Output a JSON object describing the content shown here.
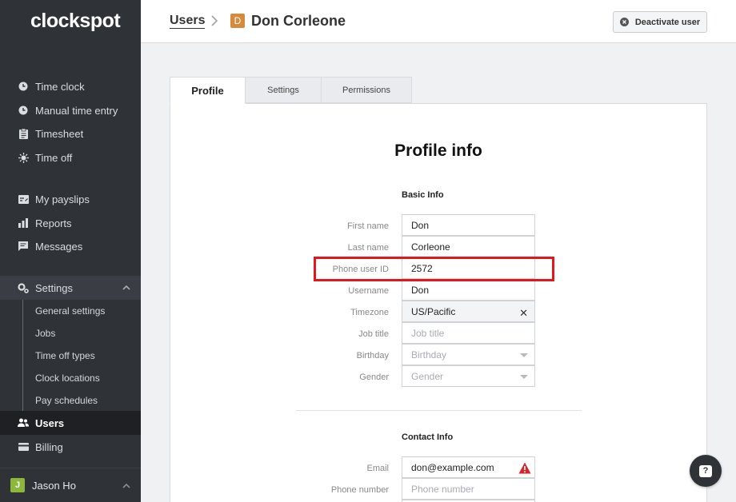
{
  "app": {
    "logo": "clockspot"
  },
  "sidebar": {
    "group1": [
      {
        "label": "Time clock",
        "icon": "clock-icon"
      },
      {
        "label": "Manual time entry",
        "icon": "clock-icon"
      },
      {
        "label": "Timesheet",
        "icon": "clipboard-icon"
      },
      {
        "label": "Time off",
        "icon": "sun-icon"
      }
    ],
    "group2": [
      {
        "label": "My payslips",
        "icon": "payslip-icon"
      },
      {
        "label": "Reports",
        "icon": "bar-chart-icon"
      },
      {
        "label": "Messages",
        "icon": "message-icon"
      }
    ],
    "settings": {
      "label": "Settings",
      "icon": "gears-icon",
      "subitems": [
        "General settings",
        "Jobs",
        "Time off types",
        "Clock locations",
        "Pay schedules"
      ]
    },
    "users": {
      "label": "Users",
      "icon": "users-icon"
    },
    "billing": {
      "label": "Billing",
      "icon": "credit-card-icon"
    },
    "user": {
      "initial": "J",
      "name": "Jason Ho"
    }
  },
  "header": {
    "breadcrumb": "Users",
    "user_initial": "D",
    "user_name": "Don Corleone",
    "deactivate_label": "Deactivate user"
  },
  "tabs": [
    "Profile",
    "Settings",
    "Permissions"
  ],
  "profile": {
    "title": "Profile info",
    "basic_title": "Basic Info",
    "basic_fields": [
      {
        "label": "First name",
        "value": "Don"
      },
      {
        "label": "Last name",
        "value": "Corleone"
      },
      {
        "label": "Phone user ID",
        "value": "2572"
      },
      {
        "label": "Username",
        "value": "Don"
      },
      {
        "label": "Timezone",
        "value": "US/Pacific"
      },
      {
        "label": "Job title",
        "placeholder": "Job title"
      },
      {
        "label": "Birthday",
        "placeholder": "Birthday"
      },
      {
        "label": "Gender",
        "placeholder": "Gender"
      }
    ],
    "contact_title": "Contact Info",
    "contact_fields": [
      {
        "label": "Email",
        "value": "don@example.com"
      },
      {
        "label": "Phone number",
        "placeholder": "Phone number"
      }
    ]
  },
  "colors": {
    "sidebar": "#2f3237",
    "highlight": "#e3161c",
    "avatar_user": "#d78a3b",
    "avatar_me": "#8bb83a"
  }
}
